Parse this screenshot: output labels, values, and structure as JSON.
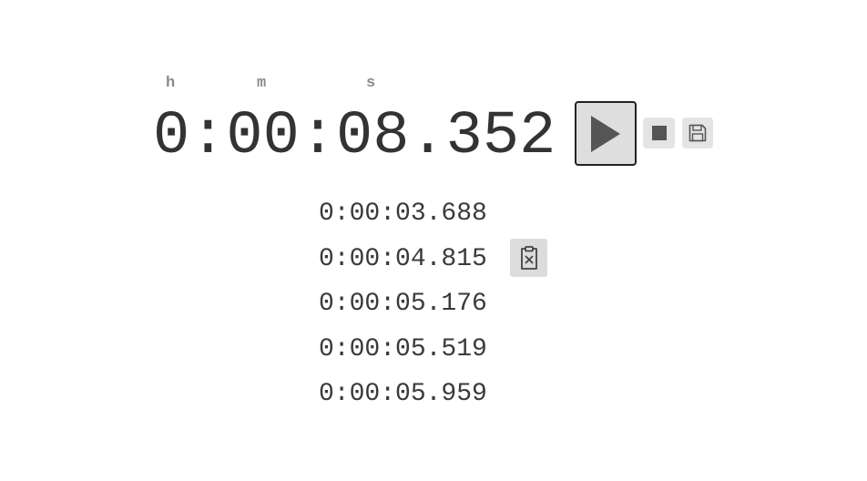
{
  "stopwatch": {
    "units": {
      "hours": "h",
      "minutes": "m",
      "seconds": "s"
    },
    "current_time": "0:00:08.352"
  },
  "controls": {
    "play_icon": "play-icon",
    "stop_icon": "stop-icon",
    "save_icon": "save-icon"
  },
  "laps": [
    {
      "time": "0:00:03.688"
    },
    {
      "time": "0:00:04.815"
    },
    {
      "time": "0:00:05.176"
    },
    {
      "time": "0:00:05.519"
    },
    {
      "time": "0:00:05.959"
    }
  ],
  "lap_actions": {
    "delete_icon": "clipboard-delete-icon"
  },
  "colors": {
    "text": "#333333",
    "label": "#8a8a8a",
    "button_bg": "#e4e4e4",
    "button_border": "#222222"
  }
}
